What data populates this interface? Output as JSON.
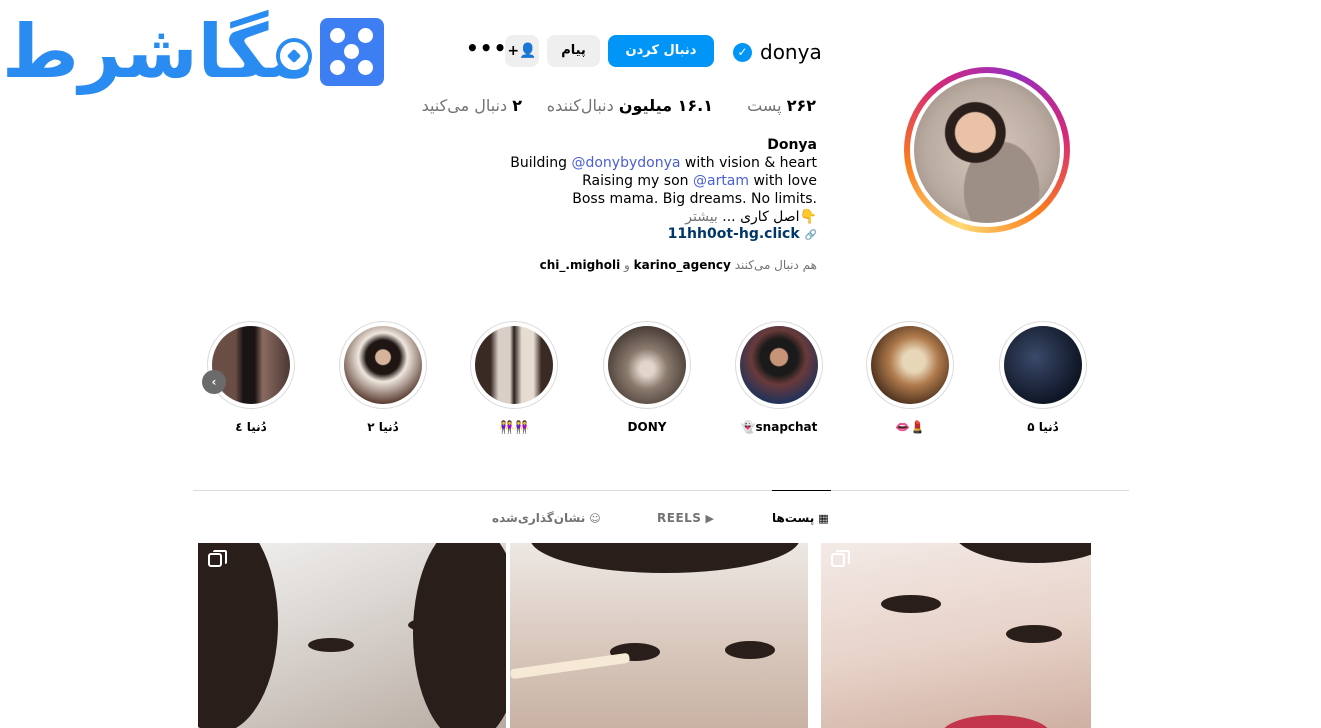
{
  "watermark": {
    "text": "مگاشرط"
  },
  "profile": {
    "username": "donya",
    "verified_mark": "✓",
    "follow_label": "دنبال کردن",
    "message_label": "پیام",
    "add_friend_icon": "+👤",
    "more_label": "•••",
    "stats": {
      "posts_count": "۲۶۲",
      "posts_label": "پست",
      "followers_count": "۱۶.۱ میلیون",
      "followers_label": "دنبال‌کننده",
      "following_prefix": "دنبال می‌کنید",
      "following_count": "۲"
    },
    "bio": {
      "name": "Donya",
      "line1_pre": "Building ",
      "line1_mention": "@donybydonya",
      "line1_post": " with vision & heart",
      "line2_pre": "Raising my son ",
      "line2_mention": "@artam",
      "line2_post": " with love",
      "line3": "Boss mama. Big dreams. No limits.",
      "line4_text": "👇اصل کاری ...",
      "line4_more": "بیشتر"
    },
    "link": "11hh0ot-hg.click",
    "link_icon": "🔗",
    "mutual": {
      "prefix": "هم دنبال می‌کنند",
      "user1": "karino_agency",
      "joiner": "و",
      "user2": "chi_.migholi"
    }
  },
  "highlights": [
    {
      "label": "دُنیا ۵"
    },
    {
      "label": "💄👄"
    },
    {
      "label": "snapchat👻"
    },
    {
      "label": "DONY"
    },
    {
      "label": "👭👭"
    },
    {
      "label": "دُنیا ۲"
    },
    {
      "label": "دُنیا ٤"
    }
  ],
  "highlights_prev_icon": "‹",
  "tabs": {
    "posts": "پست‌ها",
    "reels": "REELS",
    "tagged": "نشان‌گذاری‌شده",
    "posts_icon": "▦",
    "reels_icon": "▶",
    "tagged_icon": "☺"
  }
}
